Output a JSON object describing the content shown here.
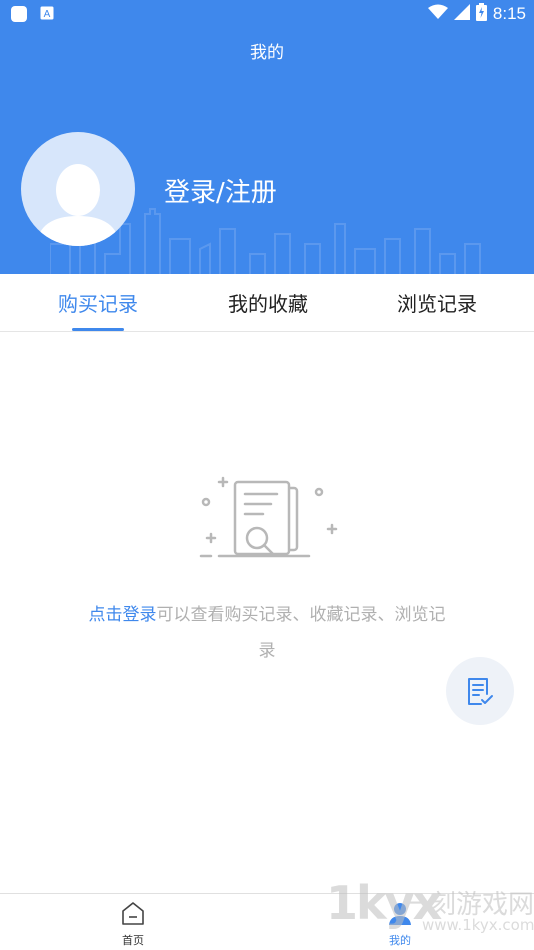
{
  "colors": {
    "primary": "#3f88ec",
    "header_bg": "#3f88ec",
    "muted_text": "#b0b0b0"
  },
  "status_bar": {
    "time": "8:15"
  },
  "header": {
    "title": "我的",
    "login_label": "登录/注册"
  },
  "tabs": [
    {
      "label": "购买记录",
      "active": true
    },
    {
      "label": "我的收藏",
      "active": false
    },
    {
      "label": "浏览记录",
      "active": false
    }
  ],
  "empty_state": {
    "link_text": "点击登录",
    "message": "可以查看购买记录、收藏记录、浏览记录"
  },
  "bottom_nav": [
    {
      "label": "首页",
      "icon": "home-icon",
      "active": false
    },
    {
      "label": "我的",
      "icon": "user-icon",
      "active": true
    }
  ],
  "watermark": {
    "big": "1kyx",
    "cn": "一刻游戏网",
    "url": "www.1kyx.com"
  }
}
